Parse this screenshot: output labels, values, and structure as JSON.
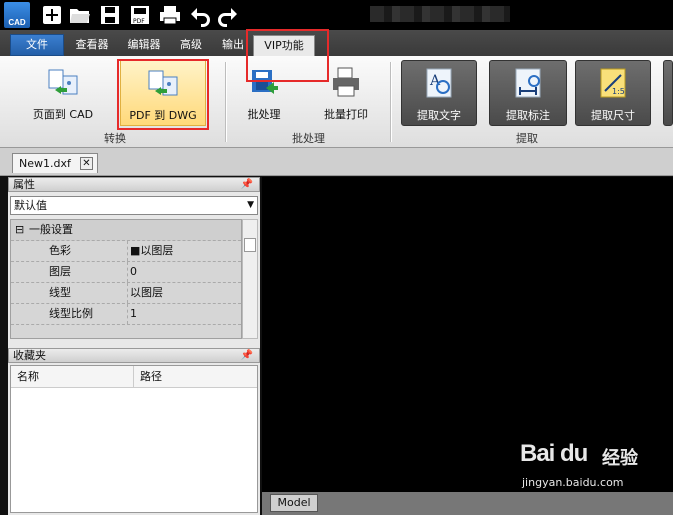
{
  "titlebar": {
    "app_logo_text": "CAD",
    "quick_access": [
      "new-icon",
      "open-icon",
      "save-icon",
      "export-pdf-icon",
      "print-icon",
      "undo-icon",
      "redo-icon"
    ]
  },
  "menu": {
    "tabs": [
      "文件",
      "查看器",
      "编辑器",
      "高级",
      "输出",
      "VIP功能"
    ]
  },
  "ribbon": {
    "convert": {
      "page_to_cad": "页面到 CAD",
      "pdf_to_dwg": "PDF 到 DWG",
      "group": "转换"
    },
    "batch": {
      "batch_process": "批处理",
      "batch_print": "批量打印",
      "group": "批处理"
    },
    "extract": {
      "extract_text": "提取文字",
      "extract_dim": "提取标注",
      "extract_size": "提取尺寸",
      "group": "提取"
    }
  },
  "document": {
    "tab": "New1.dxf",
    "close": "✕"
  },
  "properties": {
    "title": "属性",
    "select_value": "默认值",
    "section": "一般设置",
    "rows": [
      {
        "key": "色彩",
        "value": "■以图层"
      },
      {
        "key": "图层",
        "value": "0"
      },
      {
        "key": "线型",
        "value": "以图层"
      },
      {
        "key": "线型比例",
        "value": "1"
      }
    ]
  },
  "favorites": {
    "title": "收藏夹",
    "col_name": "名称",
    "col_path": "路径"
  },
  "canvas": {
    "model_tab": "Model"
  },
  "watermark": {
    "brand": "Bai du",
    "jingyan": "经验",
    "url": "jingyan.baidu.com"
  },
  "colors": {
    "accent": "#235fa8",
    "highlight": "#e62a2a",
    "canvas": "#000000"
  }
}
